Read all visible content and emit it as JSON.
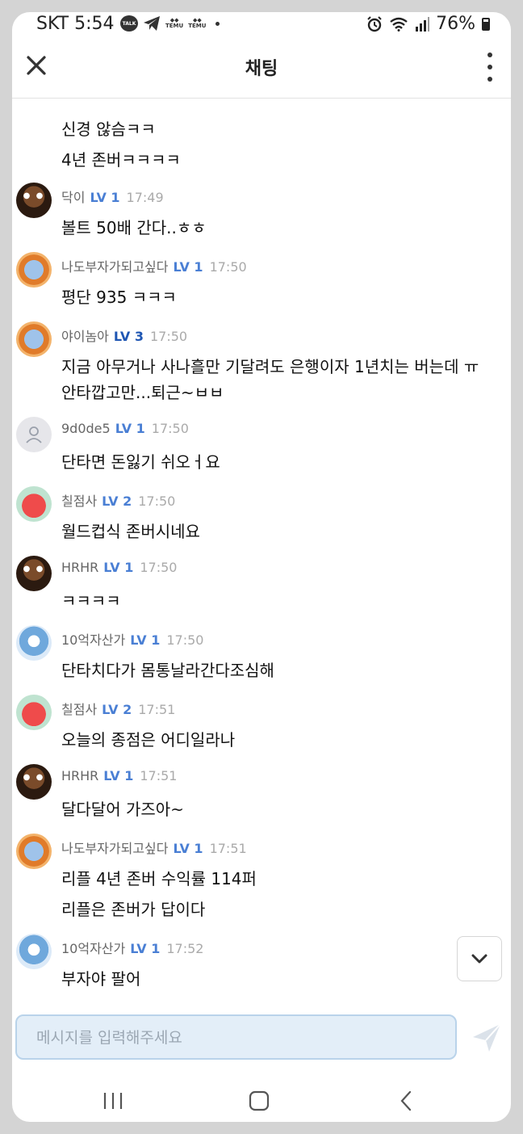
{
  "status": {
    "carrier_time": "SKT 5:54",
    "talk": "TALK",
    "temu1": "TEMU",
    "temu2": "TEMU",
    "battery": "76%"
  },
  "header": {
    "title": "채팅"
  },
  "messages": [
    {
      "nick": null,
      "lines": [
        "신경 않슴ㅋㅋ",
        "4년 존버ㅋㅋㅋㅋ"
      ]
    },
    {
      "nick": "닥이",
      "level": "LV 1",
      "time": "17:49",
      "avatar": "dark-creature",
      "lines": [
        "볼트 50배 간다..ㅎㅎ"
      ]
    },
    {
      "nick": "나도부자가되고싶다",
      "level": "LV 1",
      "time": "17:50",
      "avatar": "orange-ring-bear",
      "lines": [
        "평단 935 ㅋㅋㅋ"
      ]
    },
    {
      "nick": "야이놈아",
      "level": "LV 3",
      "time": "17:50",
      "avatar": "orange-ring-bear",
      "lines": [
        "지금 아무거나 사나흘만 기달려도 은행이자 1년치는 버는데 ㅠ",
        "안타깝고만...퇴근~ㅂㅂ"
      ]
    },
    {
      "nick": "9d0de5",
      "level": "LV 1",
      "time": "17:50",
      "avatar": "default-user",
      "lines": [
        "단타면 돈잃기  쉬오ㅓ요"
      ]
    },
    {
      "nick": "칠점사",
      "level": "LV 2",
      "time": "17:50",
      "avatar": "red-creature",
      "lines": [
        "월드컵식 존버시네요"
      ]
    },
    {
      "nick": "HRHR",
      "level": "LV 1",
      "time": "17:50",
      "avatar": "dark-creature",
      "lines": [
        "ㅋㅋㅋㅋ"
      ]
    },
    {
      "nick": "10억자산가",
      "level": "LV 1",
      "time": "17:50",
      "avatar": "blue-bear",
      "lines": [
        "단타치다가 몸통날라간다조심해"
      ]
    },
    {
      "nick": "칠점사",
      "level": "LV 2",
      "time": "17:51",
      "avatar": "red-creature",
      "lines": [
        "오늘의 종점은 어디일라나"
      ]
    },
    {
      "nick": "HRHR",
      "level": "LV 1",
      "time": "17:51",
      "avatar": "dark-creature",
      "lines": [
        "달다달어 가즈아~"
      ]
    },
    {
      "nick": "나도부자가되고싶다",
      "level": "LV 1",
      "time": "17:51",
      "avatar": "orange-ring-bear",
      "lines": [
        "리플 4년 존버 수익률 114퍼",
        "리플은 존버가 답이다"
      ]
    },
    {
      "nick": "10억자산가",
      "level": "LV 1",
      "time": "17:52",
      "avatar": "blue-bear",
      "lines": [
        "부자야 팔어"
      ]
    }
  ],
  "composer": {
    "placeholder": "메시지를 입력해주세요",
    "value": ""
  },
  "icons": {
    "close": "close-icon",
    "more": "more-vertical-icon",
    "scroll": "chevron-down-icon",
    "send": "send-icon"
  },
  "colors": {
    "level": "#4a7fd4",
    "level3": "#1f56b3",
    "input_bg": "#e3eef8"
  }
}
